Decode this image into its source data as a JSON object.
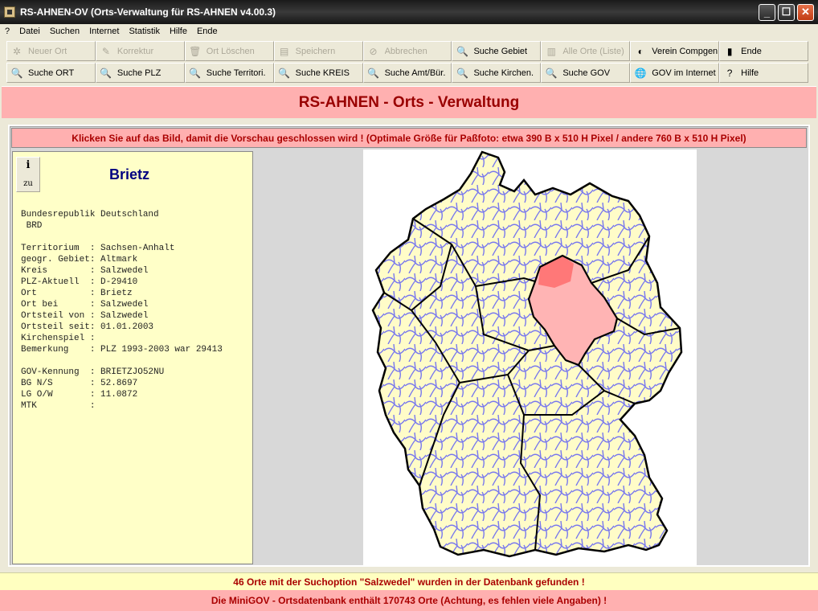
{
  "window": {
    "title": "RS-AHNEN-OV (Orts-Verwaltung für RS-AHNEN v4.00.3)",
    "minimize": "_",
    "maximize": "☐",
    "close": "✕"
  },
  "menu": [
    "?",
    "Datei",
    "Suchen",
    "Internet",
    "Statistik",
    "Hilfe",
    "Ende"
  ],
  "toolbar": {
    "row1": [
      {
        "label": "Neuer Ort",
        "icon": "new-place-icon",
        "glyph": "✲",
        "enabled": false
      },
      {
        "label": "Korrektur",
        "icon": "edit-icon",
        "glyph": "✎",
        "enabled": false
      },
      {
        "label": "Ort Löschen",
        "icon": "trash-icon",
        "glyph": "🗑",
        "enabled": false
      },
      {
        "label": "Speichern",
        "icon": "save-icon",
        "glyph": "▤",
        "enabled": false
      },
      {
        "label": "Abbrechen",
        "icon": "cancel-icon",
        "glyph": "⊘",
        "enabled": false
      },
      {
        "label": "Suche Gebiet",
        "icon": "search-doc-icon",
        "glyph": "🔍",
        "enabled": true
      },
      {
        "label": "Alle Orte (Liste)",
        "icon": "list-icon",
        "glyph": "▥",
        "enabled": false
      },
      {
        "label": "Verein Compgen",
        "icon": "compgen-icon",
        "glyph": "◐",
        "enabled": true
      },
      {
        "label": "Ende",
        "icon": "exit-door-icon",
        "glyph": "▮",
        "enabled": true
      }
    ],
    "row2": [
      {
        "label": "Suche ORT",
        "icon": "search-doc-icon",
        "glyph": "🔍",
        "enabled": true
      },
      {
        "label": "Suche PLZ",
        "icon": "search-doc-icon",
        "glyph": "🔍",
        "enabled": true
      },
      {
        "label": "Suche Territori.",
        "icon": "search-doc-icon",
        "glyph": "🔍",
        "enabled": true
      },
      {
        "label": "Suche KREIS",
        "icon": "search-doc-icon",
        "glyph": "🔍",
        "enabled": true
      },
      {
        "label": "Suche Amt/Bür.",
        "icon": "search-doc-icon",
        "glyph": "🔍",
        "enabled": true
      },
      {
        "label": "Suche Kirchen.",
        "icon": "search-doc-icon",
        "glyph": "🔍",
        "enabled": true
      },
      {
        "label": "Suche GOV",
        "icon": "search-doc-icon",
        "glyph": "🔍",
        "enabled": true
      },
      {
        "label": "GOV im Internet",
        "icon": "globe-icon",
        "glyph": "🌐",
        "enabled": true
      },
      {
        "label": "Hilfe",
        "icon": "help-icon",
        "glyph": "?",
        "enabled": true
      }
    ]
  },
  "header": "RS-AHNEN - Orts - Verwaltung",
  "hint": "Klicken Sie auf das Bild, damit die Vorschau geschlossen wird ! (Optimale Größe für Paßfoto: etwa 390 B x 510 H Pixel / andere 760 B x 510 H Pixel)",
  "info": {
    "button_top": "i",
    "button_bottom": "zu",
    "place": "Brietz",
    "lines": [
      "Bundesrepublik Deutschland",
      " BRD",
      "",
      "Territorium  : Sachsen-Anhalt",
      "geogr. Gebiet: Altmark",
      "Kreis        : Salzwedel",
      "PLZ-Aktuell  : D-29410",
      "Ort          : Brietz",
      "Ort bei      : Salzwedel",
      "Ortsteil von : Salzwedel",
      "Ortsteil seit: 01.01.2003",
      "Kirchenspiel :",
      "Bemerkung    : PLZ 1993-2003 war 29413",
      "",
      "GOV-Kennung  : BRIETZJO52NU",
      "BG N/S       : 52.8697",
      "LG O/W       : 11.0872",
      "MTK          :"
    ]
  },
  "map": {
    "fill": "#fffcc8",
    "district_line": "#7878ee",
    "state_line": "#000000",
    "highlight_state": "#ffb4b4",
    "highlight_district": "#ff7878"
  },
  "status": {
    "found": "46 Orte mit der Suchoption \"Salzwedel\" wurden in der Datenbank gefunden !",
    "db": "Die MiniGOV - Ortsdatenbank enthält 170743 Orte (Achtung, es fehlen viele Angaben) !"
  }
}
